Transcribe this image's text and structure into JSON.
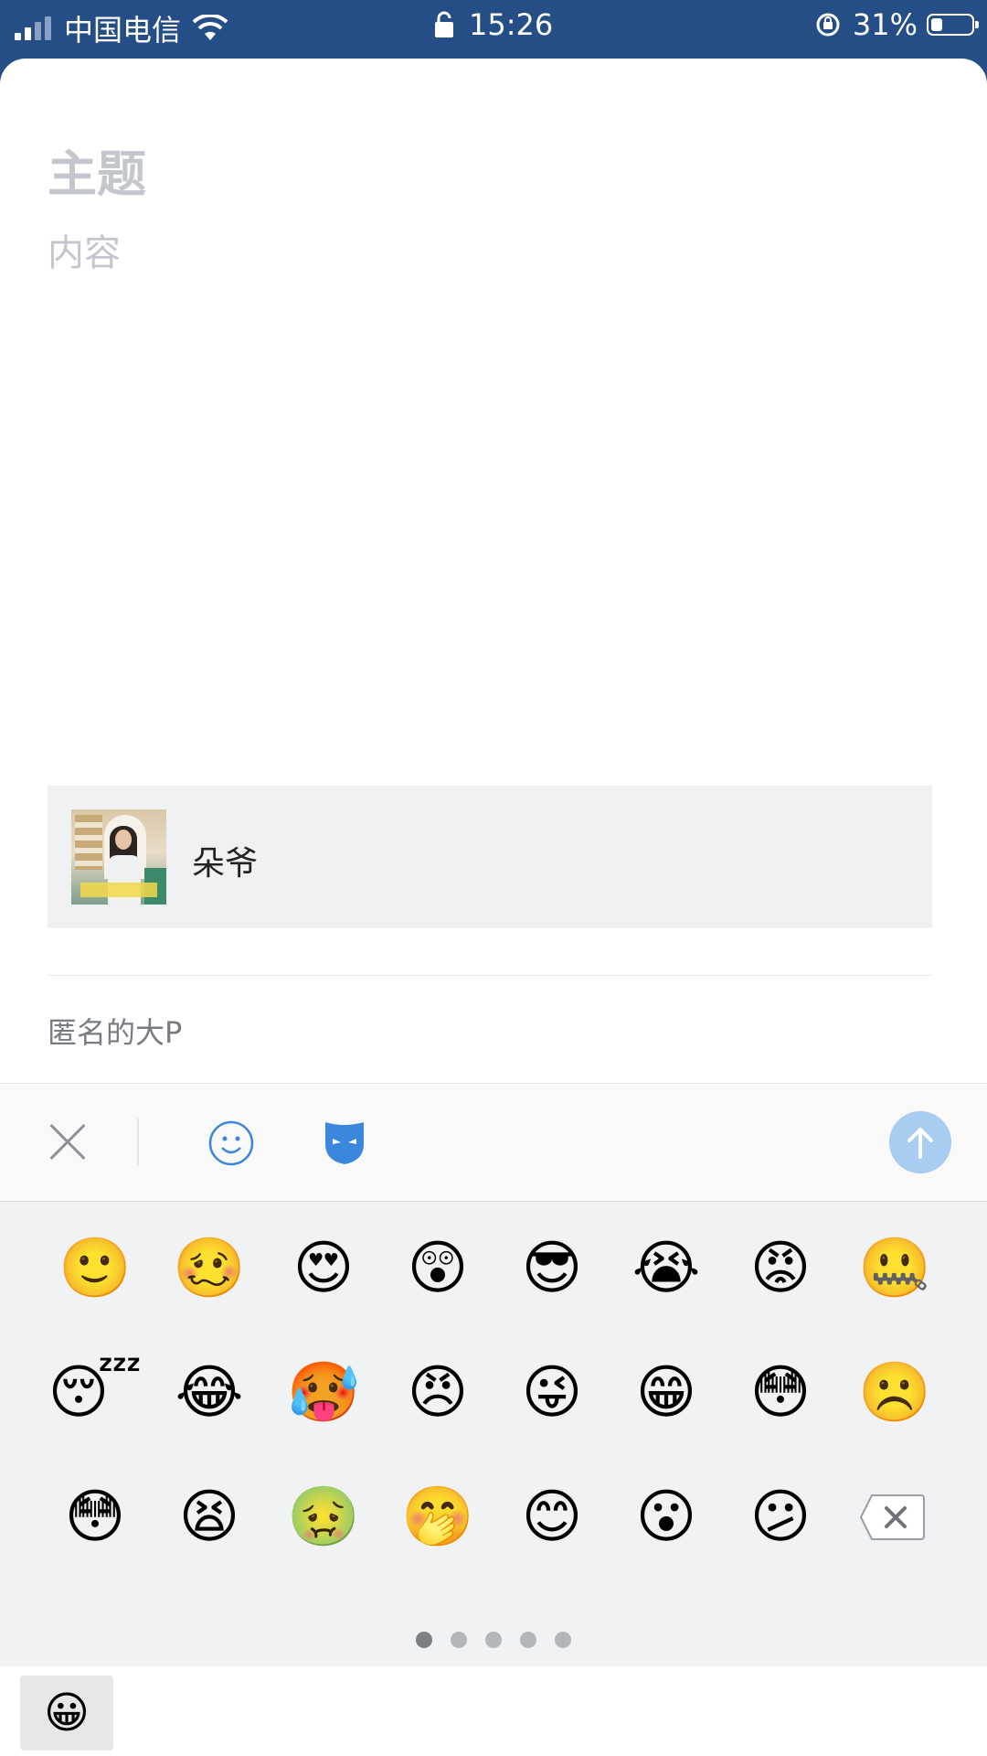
{
  "status_bar": {
    "carrier": "中国电信",
    "time": "15:26",
    "battery_percent": "31%",
    "battery_level": 0.31,
    "signal_bars_filled": 2,
    "signal_bars_total": 4
  },
  "compose": {
    "subject_placeholder": "主题",
    "content_placeholder": "内容"
  },
  "attachment": {
    "name": "朵爷",
    "thumbnail_icon": "photo-thumbnail"
  },
  "anonymous_label": "匿名的大P",
  "toolbar": {
    "close_icon": "close-icon",
    "emoji_icon": "smiley-icon",
    "mask_icon": "mask-icon",
    "send_icon": "arrow-up-icon",
    "accent_color": "#3b87dd",
    "send_color": "#a8cdf1"
  },
  "emoji_panel": {
    "rows": [
      [
        "🙂",
        "🥴",
        "😍",
        "😲",
        "😎",
        "😭",
        "😡",
        "🤐"
      ],
      [
        "😴",
        "😂",
        "🥵",
        "😠",
        "😜",
        "😁",
        "😳",
        "☹️"
      ],
      [
        "😳",
        "😫",
        "🤢",
        "🤭",
        "😊",
        "😮",
        "😕"
      ]
    ],
    "backspace_icon": "backspace-icon",
    "page_count": 5,
    "active_page": 1
  },
  "bottom_bar": {
    "emoji_tab": "😀"
  }
}
